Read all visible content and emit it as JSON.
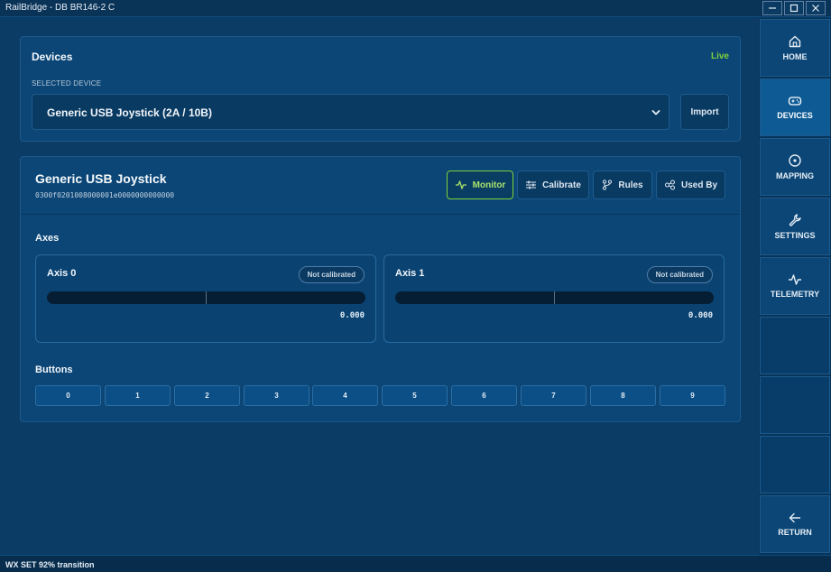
{
  "window": {
    "title": "RailBridge - DB BR146-2 C"
  },
  "devices": {
    "title": "Devices",
    "live_label": "Live",
    "selected_label": "SELECTED DEVICE",
    "selected_value": "Generic USB Joystick (2A / 10B)",
    "import_label": "Import"
  },
  "device": {
    "name": "Generic USB Joystick",
    "guid": "0300f0201008000001e0000000000000",
    "tabs": [
      {
        "label": "Monitor",
        "icon": "pulse-icon"
      },
      {
        "label": "Calibrate",
        "icon": "sliders-icon"
      },
      {
        "label": "Rules",
        "icon": "branch-icon"
      },
      {
        "label": "Used By",
        "icon": "link-icon"
      }
    ]
  },
  "axes": {
    "label": "Axes",
    "items": [
      {
        "name": "Axis 0",
        "badge": "Not calibrated",
        "value": "0.000",
        "level": 0.0
      },
      {
        "name": "Axis 1",
        "badge": "Not calibrated",
        "value": "0.000",
        "level": 0.0
      }
    ]
  },
  "buttons": {
    "label": "Buttons",
    "items": [
      "0",
      "1",
      "2",
      "3",
      "4",
      "5",
      "6",
      "7",
      "8",
      "9"
    ]
  },
  "sidebar": {
    "items": [
      {
        "label": "HOME",
        "icon": "home-icon"
      },
      {
        "label": "DEVICES",
        "icon": "gamepad-icon",
        "active": true
      },
      {
        "label": "MAPPING",
        "icon": "target-icon"
      },
      {
        "label": "SETTINGS",
        "icon": "wrench-icon"
      },
      {
        "label": "TELEMETRY",
        "icon": "pulse-icon"
      }
    ],
    "return_label": "RETURN",
    "return_icon": "arrow-left-icon"
  },
  "status": {
    "text": "WX SET 92% transition"
  },
  "colors": {
    "accent": "#7ed23a",
    "background": "#0b3a62",
    "panel": "#0b4676"
  }
}
